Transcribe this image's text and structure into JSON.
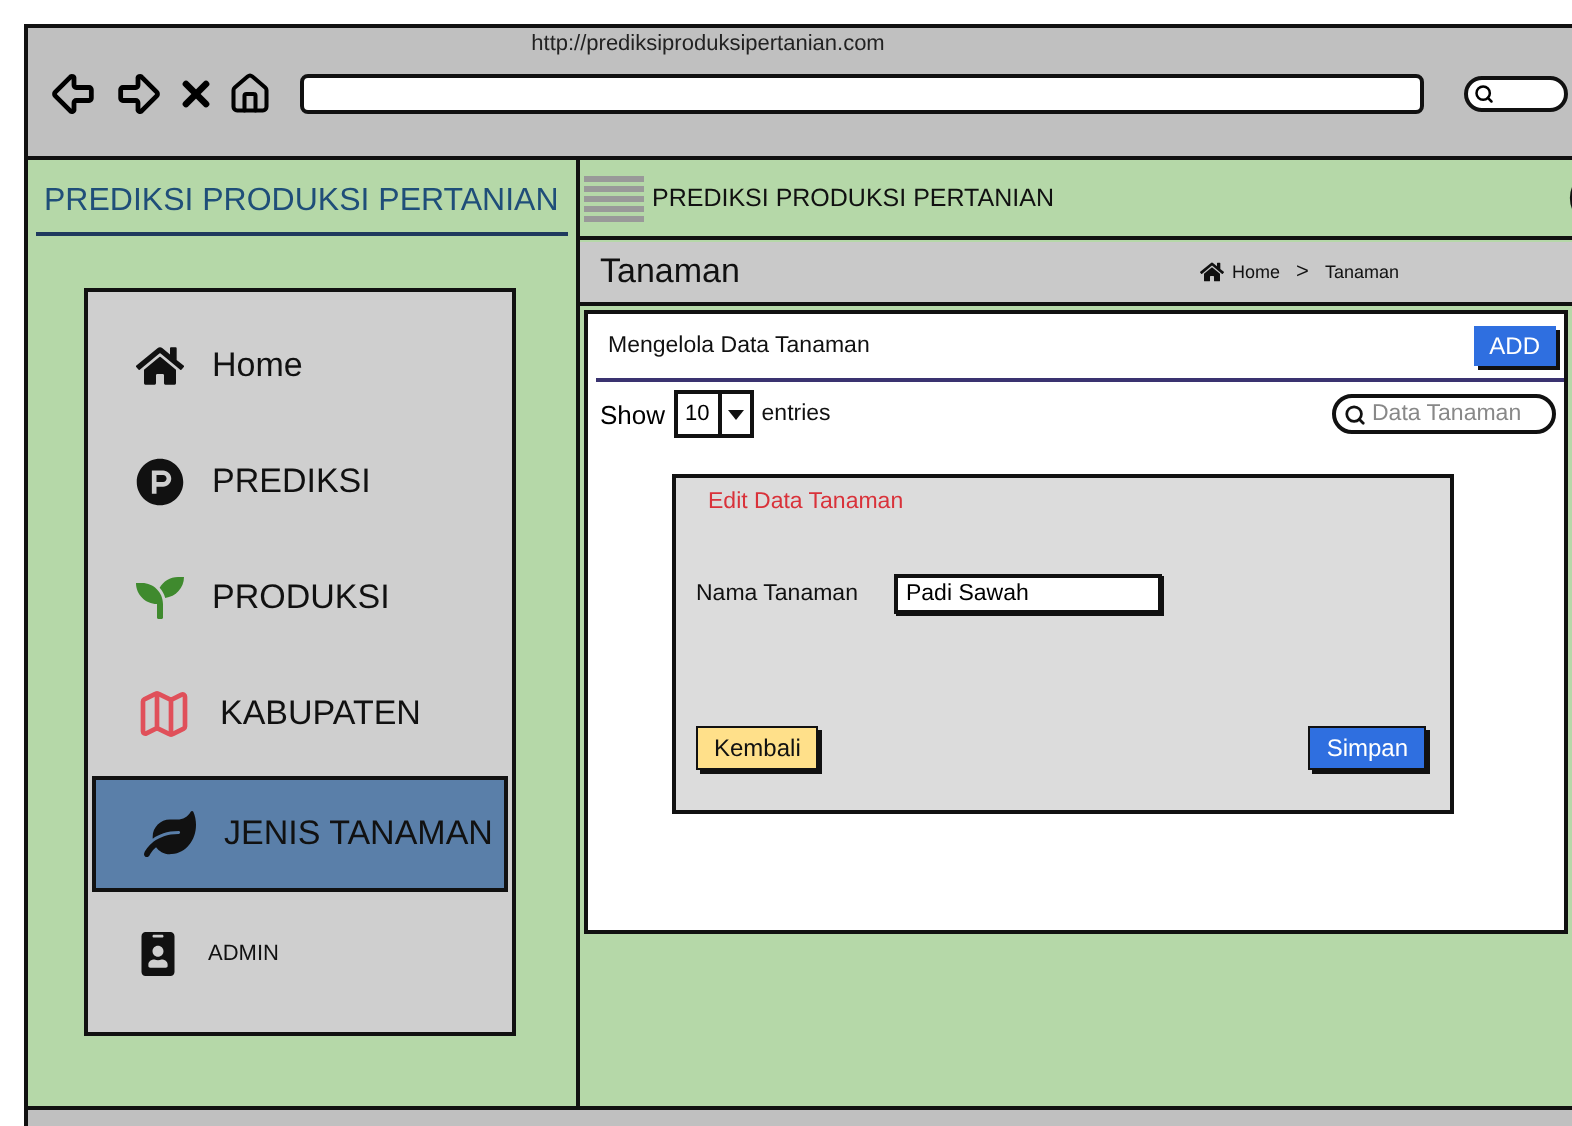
{
  "browser": {
    "url": "http://prediksiproduksipertanian.com"
  },
  "sidebar": {
    "title": "PREDIKSI PRODUKSI PERTANIAN",
    "items": [
      {
        "label": "Home",
        "selected": false
      },
      {
        "label": "PREDIKSI",
        "selected": false
      },
      {
        "label": "PRODUKSI",
        "selected": false
      },
      {
        "label": "KABUPATEN",
        "selected": false
      },
      {
        "label": "JENIS TANAMAN",
        "selected": true
      },
      {
        "label": "ADMIN",
        "selected": false
      }
    ]
  },
  "header": {
    "title": "PREDIKSI PRODUKSI PERTANIAN"
  },
  "page": {
    "title": "Tanaman",
    "breadcrumb": {
      "items": [
        "Home",
        "Tanaman"
      ],
      "separator": ">"
    }
  },
  "panel": {
    "title": "Mengelola Data Tanaman",
    "add_button": "ADD",
    "show_label": "Show",
    "entries_value": "10",
    "entries_label": "entries",
    "search": {
      "placeholder": "Data Tanaman"
    }
  },
  "dialog": {
    "title": "Edit Data Tanaman",
    "field_label": "Nama Tanaman",
    "field_value": "Padi Sawah",
    "buttons": [
      {
        "label": "Kembali",
        "kind": "secondary"
      },
      {
        "label": "Simpan",
        "kind": "primary"
      }
    ]
  }
}
